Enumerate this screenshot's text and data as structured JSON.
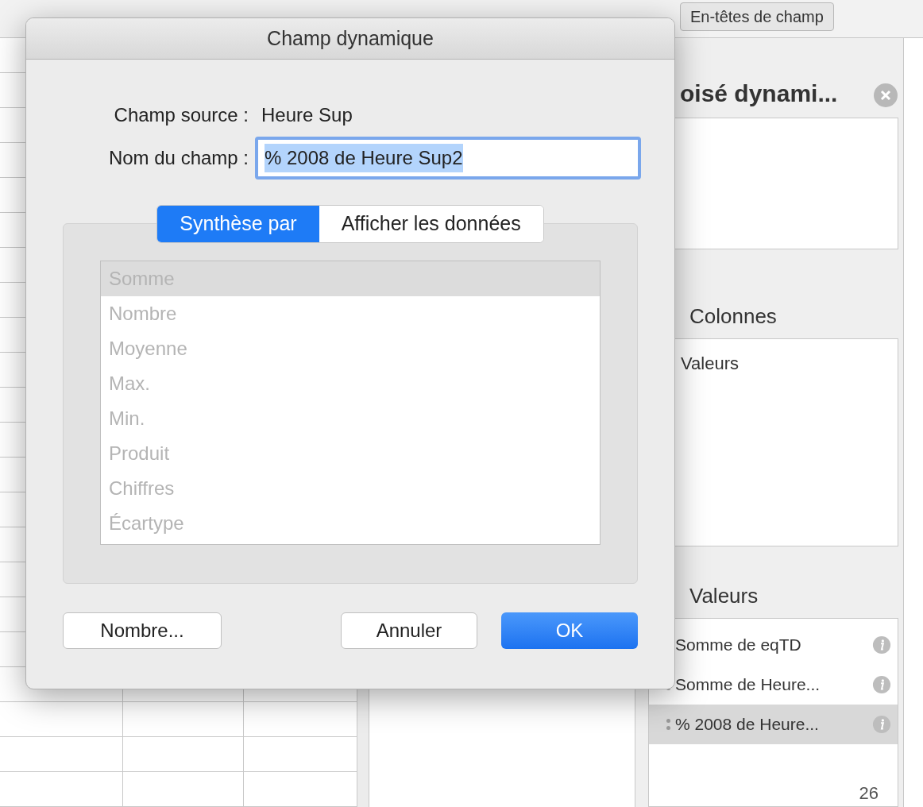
{
  "ribbon": {
    "button": "En-têtes de champ"
  },
  "pane": {
    "title": "oisé dynami...",
    "columns_label": "Colonnes",
    "columns_items": [
      "Valeurs"
    ],
    "values_label": "Valeurs",
    "values_items": [
      {
        "label": "Somme de eqTD",
        "selected": false
      },
      {
        "label": "Somme de Heure...",
        "selected": false
      },
      {
        "label": "% 2008 de Heure...",
        "selected": true
      }
    ]
  },
  "page_number": "26",
  "dialog": {
    "title": "Champ dynamique",
    "source_label": "Champ source :",
    "source_value": "Heure Sup",
    "name_label": "Nom du champ :",
    "name_value": "% 2008 de Heure Sup2",
    "tabs": [
      {
        "label": "Synthèse par",
        "selected": true
      },
      {
        "label": "Afficher les données",
        "selected": false
      }
    ],
    "list_disabled": true,
    "functions": [
      {
        "label": "Somme",
        "selected": true
      },
      {
        "label": "Nombre",
        "selected": false
      },
      {
        "label": "Moyenne",
        "selected": false
      },
      {
        "label": "Max.",
        "selected": false
      },
      {
        "label": "Min.",
        "selected": false
      },
      {
        "label": "Produit",
        "selected": false
      },
      {
        "label": "Chiffres",
        "selected": false
      },
      {
        "label": "Écartype",
        "selected": false
      }
    ],
    "buttons": [
      {
        "label": "Nombre...",
        "default": false
      },
      {
        "label": "Annuler",
        "default": false
      },
      {
        "label": "OK",
        "default": true
      }
    ]
  }
}
